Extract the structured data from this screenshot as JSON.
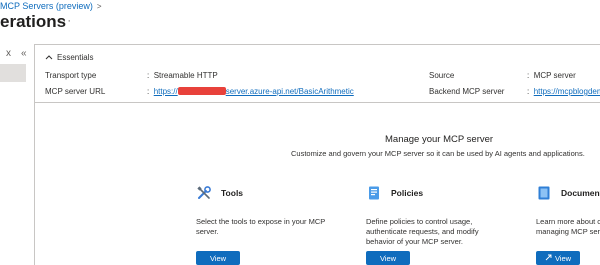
{
  "breadcrumb": {
    "text": "MCP Servers (preview)",
    "separator": ">"
  },
  "page": {
    "title": "erations",
    "more": "···"
  },
  "left_nav": {
    "collapse": "x",
    "chevrons": "«"
  },
  "essentials": {
    "header": "Essentials",
    "transport_label": "Transport type",
    "transport_value": "Streamable HTTP",
    "url_label": "MCP server URL",
    "url_prefix": "https://",
    "url_suffix": "server.azure-api.net/BasicArithmetic",
    "source_label": "Source",
    "source_value": "MCP server",
    "backend_label": "Backend MCP server",
    "backend_value": "https://mcpblogdemo",
    "colon": ":"
  },
  "manage": {
    "title": "Manage your MCP server",
    "subtitle": "Customize and govern your MCP server so it can be used by AI agents and applications."
  },
  "cards": [
    {
      "title": "Tools",
      "desc": "Select the tools to expose in your MCP server.",
      "button": "View",
      "icon": "wrench-screwdriver-icon"
    },
    {
      "title": "Policies",
      "desc": "Define policies to control usage, authenticate requests, and modify behavior of your MCP server.",
      "button": "View",
      "icon": "policy-document-icon"
    },
    {
      "title": "Documentati",
      "desc": "Learn more about cr managing MCP serve",
      "button": "View",
      "icon": "book-icon"
    }
  ],
  "colors": {
    "accent": "#0f6cbd",
    "redaction": "#e8413b"
  }
}
